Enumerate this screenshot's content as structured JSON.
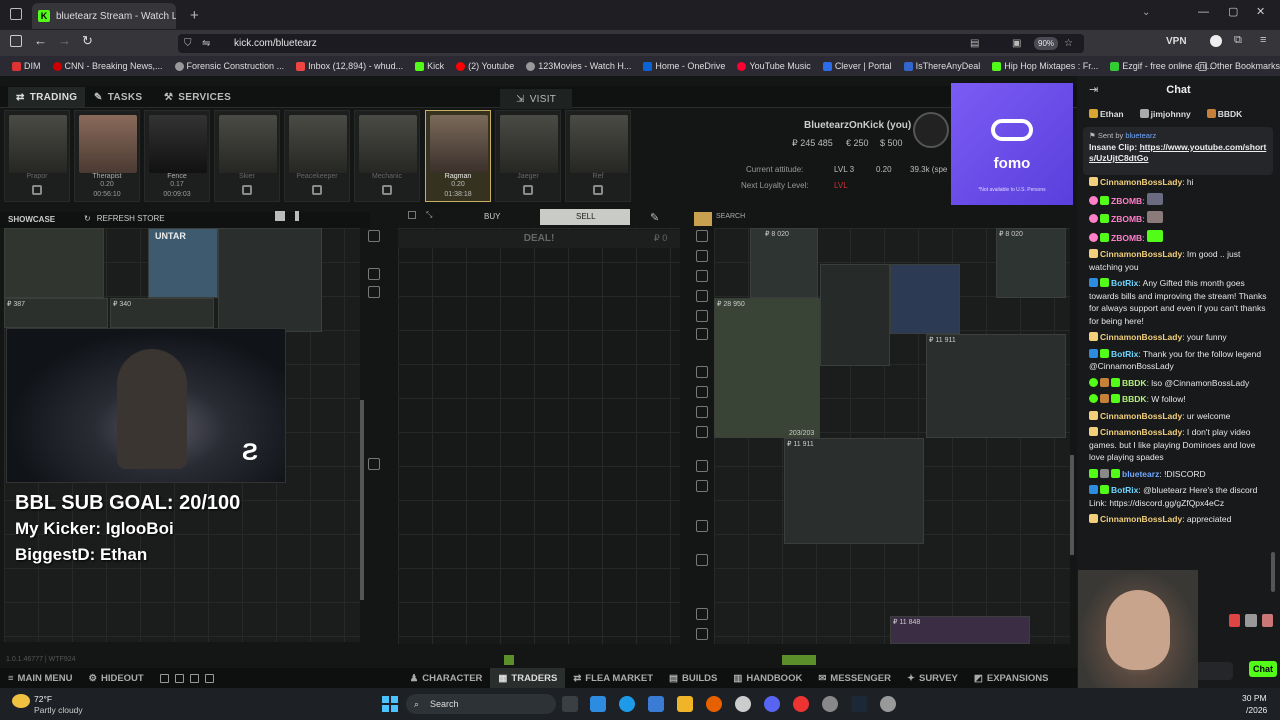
{
  "browser": {
    "tab_title": "bluetearz Stream - Watch L",
    "url": "kick.com/bluetearz",
    "zoom": "90%",
    "vpn": "VPN",
    "bookmarks": [
      "DIM",
      "CNN - Breaking News,...",
      "Forensic Construction ...",
      "Inbox (12,894) - whud...",
      "Kick",
      "(2) Youtube",
      "123Movies - Watch H...",
      "Home - OneDrive",
      "YouTube Music",
      "Clever | Portal",
      "IsThereAnyDeal",
      "Hip Hop Mixtapes : Fr...",
      "Ezgif - free online ani..."
    ],
    "other_bookmarks": "Other Bookmarks"
  },
  "game": {
    "tabs": [
      "TRADING",
      "TASKS",
      "SERVICES"
    ],
    "visit": "VISIT",
    "traders": [
      {
        "name": "Prapor",
        "locked": true
      },
      {
        "name": "Therapist",
        "locked": false,
        "level": "0.20",
        "timer": "00:56:10"
      },
      {
        "name": "Fence",
        "locked": false,
        "level": "0.17",
        "timer": "00:09:03"
      },
      {
        "name": "Skier",
        "locked": true
      },
      {
        "name": "Peacekeeper",
        "locked": true
      },
      {
        "name": "Mechanic",
        "locked": true
      },
      {
        "name": "Ragman",
        "locked": false,
        "selected": true,
        "level": "0.20",
        "timer": "01:38:18"
      },
      {
        "name": "Jaeger",
        "locked": true
      },
      {
        "name": "Ref",
        "locked": true
      }
    ],
    "player": {
      "name": "BluetearzOnKick (you)",
      "roubles": "₽ 245 485",
      "euros": "€ 250",
      "dollars": "$ 500"
    },
    "attitude": {
      "label": "Current attitude:",
      "level": "LVL 3",
      "standing": "0.20",
      "spent": "39.3k (spe"
    },
    "next_loyalty": {
      "label": "Next Loyalty Level:",
      "level": "LVL"
    },
    "showcase": "SHOWCASE",
    "refresh": "REFRESH STORE",
    "buy": "BUY",
    "sell": "SELL",
    "deal": "DEAL!",
    "deal_price": "₽ 0",
    "search": "SEARCH",
    "showcase_items": [
      {
        "price": "₽ 387"
      },
      {
        "price": "₽ 340"
      },
      {
        "tag": "UNTAR"
      }
    ],
    "stash_prices": [
      "₽ 8 020",
      "₽ 8 020",
      "₽ 28 950",
      "₽ 11 911",
      "₽ 11 911",
      "₽ 11 848"
    ],
    "durability": "203/203",
    "version": "1.0.1.46777 | WTF924",
    "bottom_bar": [
      "MAIN MENU",
      "HIDEOUT",
      "CHARACTER",
      "TRADERS",
      "FLEA MARKET",
      "BUILDS",
      "HANDBOOK",
      "MESSENGER",
      "SURVEY",
      "EXPANSIONS"
    ]
  },
  "overlay": {
    "sub_goal": "BBL SUB GOAL: 20/100",
    "kicker": "My Kicker: IglooBoi",
    "biggest": "BiggestD: Ethan"
  },
  "ad": {
    "brand": "fomo",
    "note": "*Not available to U.S. Persons"
  },
  "chat": {
    "title": "Chat",
    "pinned_users": [
      "Ethan",
      "jimjohnny",
      "BBDK"
    ],
    "pinned": {
      "sent_by": "Sent by",
      "sender": "bluetearz",
      "label": "Insane Clip:",
      "link": "https://www.youtube.com/shorts/UzUjtC8dtGo"
    },
    "messages": [
      {
        "user": "CinnamonBossLady",
        "text": "hi",
        "color": "#f2d07b"
      },
      {
        "user": "ZBOMB",
        "text": "",
        "color": "#ff80c8"
      },
      {
        "user": "ZBOMB",
        "text": "",
        "color": "#ff80c8"
      },
      {
        "user": "ZBOMB",
        "text": "",
        "color": "#ff80c8"
      },
      {
        "user": "CinnamonBossLady",
        "text": "Im good .. just watching you",
        "color": "#f2d07b"
      },
      {
        "user": "BotRix",
        "text": "Any Gifted this month goes towards bills and improving the stream! Thanks for always support and even if you can't thanks for being here!",
        "color": "#6fd6ff"
      },
      {
        "user": "CinnamonBossLady",
        "text": "your funny",
        "color": "#f2d07b"
      },
      {
        "user": "BotRix",
        "text": "Thank you for the follow legend @CinnamonBossLady",
        "color": "#6fd6ff"
      },
      {
        "user": "BBDK",
        "text": "lso @CinnamonBossLady",
        "color": "#b2f17a"
      },
      {
        "user": "BBDK",
        "text": "W follow!",
        "color": "#b2f17a"
      },
      {
        "user": "CinnamonBossLady",
        "text": "ur welcome",
        "color": "#f2d07b"
      },
      {
        "user": "CinnamonBossLady",
        "text": "I don't play video games. but I like playing Dominoes and love love playing spades",
        "color": "#f2d07b"
      },
      {
        "user": "bluetearz",
        "text": "!DISCORD",
        "color": "#6fa8ff"
      },
      {
        "user": "BotRix",
        "text": "@bluetearz Here's the discord Link: https://discord.gg/gZfQpx4eCz",
        "color": "#6fd6ff"
      },
      {
        "user": "CinnamonBossLady",
        "text": "appreciated",
        "color": "#f2d07b"
      }
    ],
    "send": "Chat"
  },
  "taskbar": {
    "temp": "72°F",
    "weather": "Partly cloudy",
    "search": "Search",
    "time": "30 PM",
    "date": "/2026"
  }
}
